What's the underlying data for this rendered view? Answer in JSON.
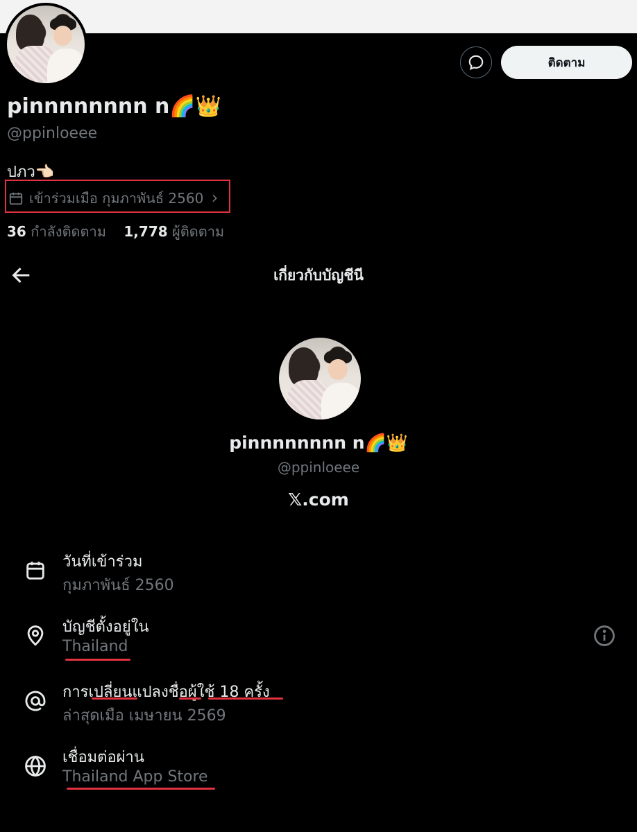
{
  "profile": {
    "display_name": "pinnnnnnnn n🌈👑",
    "handle": "@ppinloeee",
    "bio": "ปภว👈🏻",
    "joined": "เข้าร่วมเมือ กุมภาพันธ์ 2560",
    "following_count": "36",
    "following_label": "กำลังติดตาม",
    "followers_count": "1,778",
    "followers_label": "ผู้ติดตาม"
  },
  "actions": {
    "follow_label": "ติดตาม"
  },
  "about": {
    "title": "เกี่ยวกับบัญชีนี",
    "display_name": "pinnnnnnnn n🌈👑",
    "handle": "@ppinloeee",
    "site": "𝕏.com",
    "rows": [
      {
        "label": "วันที่เข้าร่วม",
        "value": "กุมภาพันธ์ 2560",
        "icon": "calendar-icon"
      },
      {
        "label": "บัญชีตั้งอยู่ใน",
        "value": "Thailand",
        "icon": "location-pin-icon"
      },
      {
        "label": "การเปลี่ยนแปลงชื่อผู้ใช้ 18 ครั้ง",
        "value": "ล่าสุดเมือ เมษายน 2569",
        "icon": "at-sign-icon"
      },
      {
        "label": "เชื่อมต่อผ่าน",
        "value": "Thailand App Store",
        "icon": "globe-icon"
      }
    ]
  },
  "colors": {
    "background": "#000000",
    "primary_text": "#e7e9ea",
    "secondary_text": "#71767b",
    "annotation_red": "#e0323f",
    "button_bg": "#eff3f4"
  }
}
